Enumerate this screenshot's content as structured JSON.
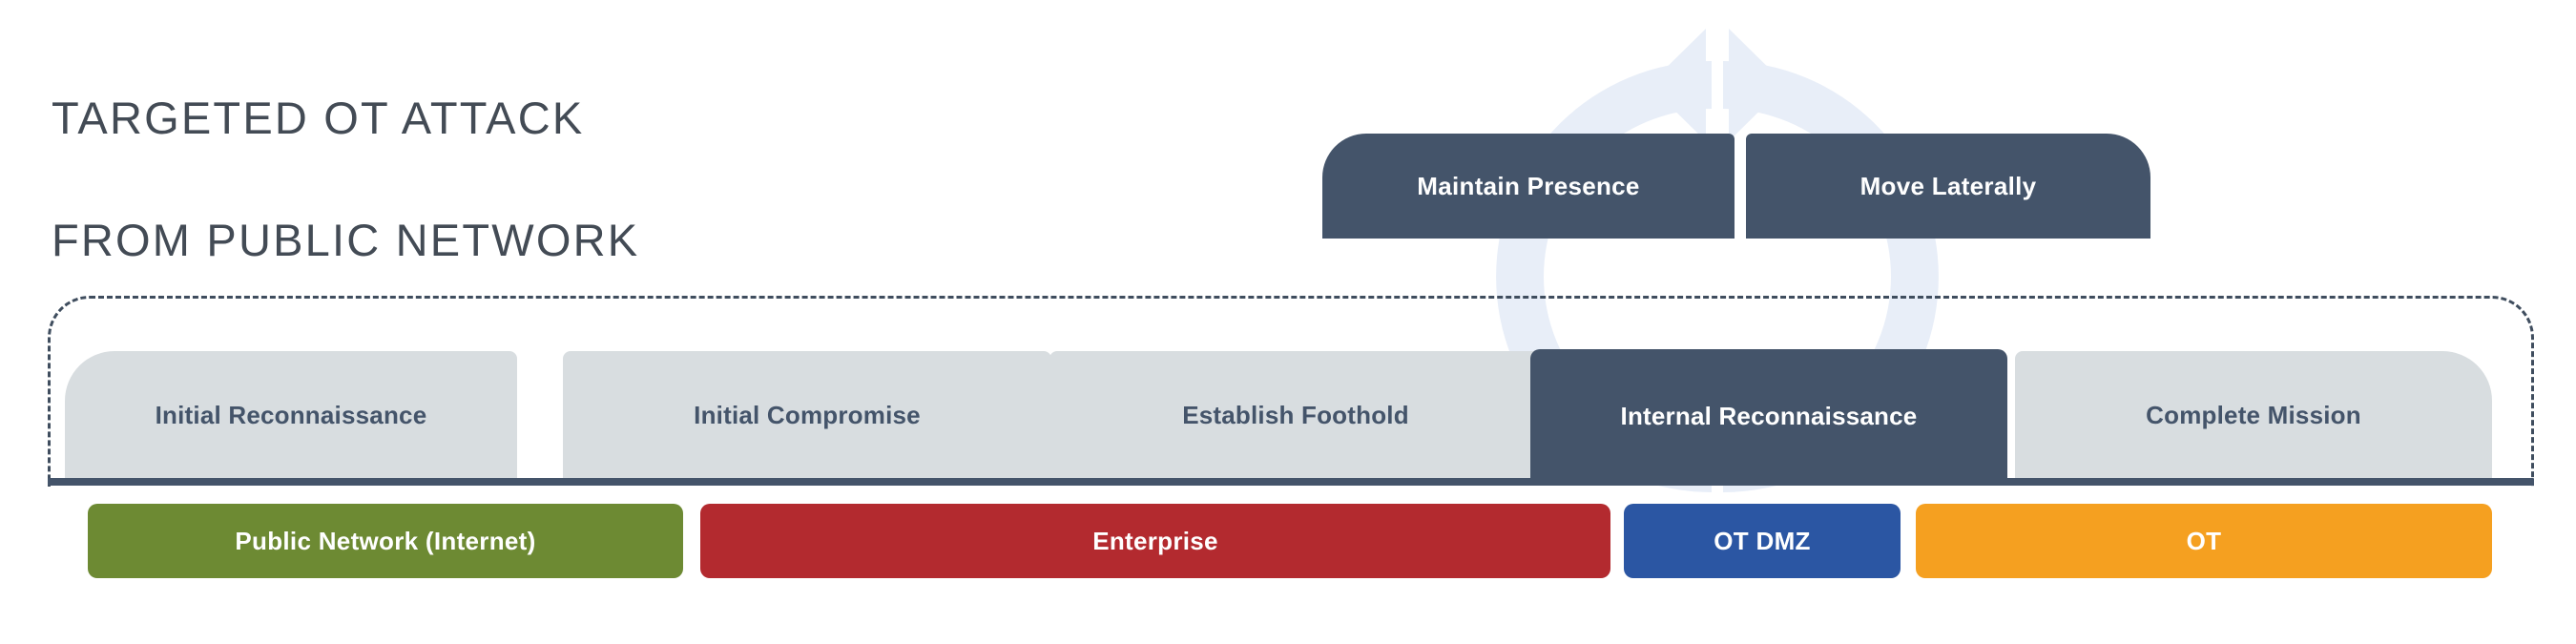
{
  "title": {
    "line1": "Targeted OT Attack",
    "line2": "From Public Network",
    "color": "#434b55"
  },
  "background": {
    "watermark_icon": "cyclical-arrow-ring-icon",
    "watermark_color": "#e8eef8"
  },
  "enclosure": {
    "style": "dashed-rounded-boundary",
    "border_color": "#3f4d5e",
    "baseline_color": "#44546a"
  },
  "top_boxes": [
    {
      "label": "Maintain Presence",
      "color": "#44546a",
      "text_color": "#ffffff"
    },
    {
      "label": "Move Laterally",
      "color": "#44546a",
      "text_color": "#ffffff"
    }
  ],
  "phases": [
    {
      "label": "Initial Reconnaissance",
      "state": "plain",
      "color": "#d8dde0",
      "text_color": "#44546a"
    },
    {
      "label": "Initial Compromise",
      "state": "plain",
      "color": "#d8dde0",
      "text_color": "#44546a"
    },
    {
      "label": "Establish Foothold",
      "state": "plain",
      "color": "#d8dde0",
      "text_color": "#44546a"
    },
    {
      "label": "Internal Reconnaissance",
      "state": "active",
      "color": "#44546a",
      "text_color": "#ffffff"
    },
    {
      "label": "Complete Mission",
      "state": "plain",
      "color": "#d8dde0",
      "text_color": "#44546a"
    }
  ],
  "zones": [
    {
      "label": "Public Network (Internet)",
      "color": "#6d8a33",
      "text_color": "#ffffff"
    },
    {
      "label": "Enterprise",
      "color": "#b32a2f",
      "text_color": "#ffffff"
    },
    {
      "label": "OT DMZ",
      "color": "#2b56a3",
      "text_color": "#ffffff"
    },
    {
      "label": "OT",
      "color": "#f5a020",
      "text_color": "#ffffff"
    }
  ]
}
